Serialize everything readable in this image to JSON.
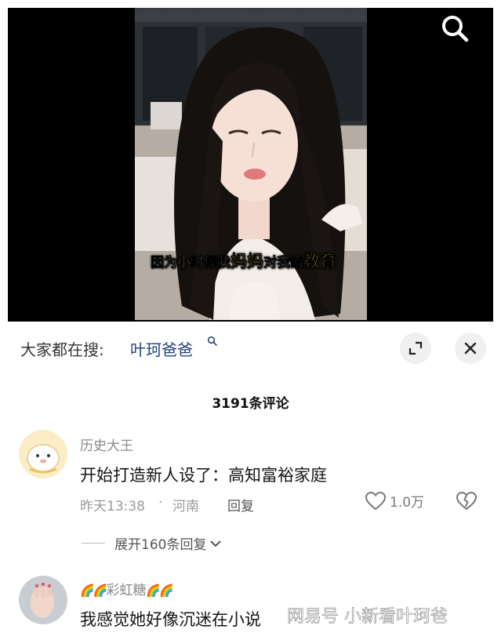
{
  "video": {
    "subtitle_parts": [
      "因为小时候我",
      "妈妈",
      "对我的",
      "教育"
    ]
  },
  "search": {
    "prefix": "大家都在搜:",
    "term": "叶珂爸爸"
  },
  "comments_header": {
    "count_label": "3191条评论"
  },
  "comments": [
    {
      "username": "历史大王",
      "text": "开始打造新人设了：高知富裕家庭",
      "time": "昨天13:38",
      "separator": "·",
      "location": "河南",
      "reply_label": "回复",
      "like_count": "1.0万",
      "expand_label": "展开160条回复"
    },
    {
      "username": "彩虹糖",
      "username_emoji": "🌈🌈",
      "text": "我感觉她好像沉迷在小说",
      "watermark": "网易号 小新看叶珂爸"
    }
  ],
  "icons": {
    "search": "search-icon",
    "expand": "fullscreen-expand-icon",
    "close": "close-icon",
    "like": "heart-outline-icon",
    "dislike": "broken-heart-icon",
    "chevron": "chevron-down-icon"
  },
  "colors": {
    "search_term": "#24457a",
    "subtitle_highlight": "#ffe14a",
    "meta_gray": "#9a9a9a"
  }
}
